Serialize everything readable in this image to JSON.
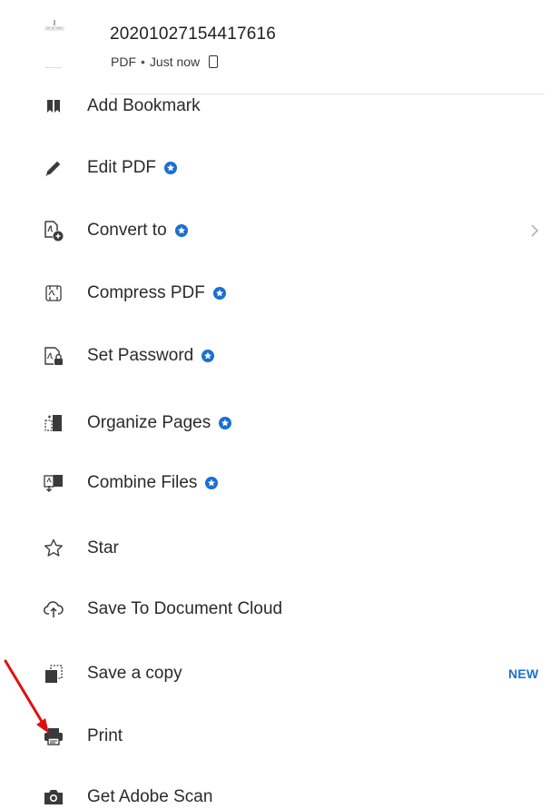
{
  "file": {
    "name": "20201027154417616",
    "type": "PDF",
    "separator": "•",
    "time": "Just now"
  },
  "menu": {
    "items": [
      {
        "label": "Add Bookmark",
        "icon": "bookmark-icon",
        "premium": false
      },
      {
        "label": "Edit PDF",
        "icon": "pencil-icon",
        "premium": true
      },
      {
        "label": "Convert to",
        "icon": "convert-icon",
        "premium": true,
        "has_submenu": true
      },
      {
        "label": "Compress PDF",
        "icon": "compress-icon",
        "premium": true
      },
      {
        "label": "Set Password",
        "icon": "lock-document-icon",
        "premium": true
      },
      {
        "label": "Organize Pages",
        "icon": "organize-pages-icon",
        "premium": true
      },
      {
        "label": "Combine Files",
        "icon": "combine-files-icon",
        "premium": true
      },
      {
        "label": "Star",
        "icon": "star-icon",
        "premium": false
      },
      {
        "label": "Save To Document Cloud",
        "icon": "cloud-upload-icon",
        "premium": false
      },
      {
        "label": "Save a copy",
        "icon": "save-copy-icon",
        "premium": false,
        "badge": "NEW"
      },
      {
        "label": "Print",
        "icon": "printer-icon",
        "premium": false
      },
      {
        "label": "Get Adobe Scan",
        "icon": "camera-icon",
        "premium": false
      }
    ]
  },
  "colors": {
    "premium_badge": "#1a6fd1",
    "new_badge": "#1a73c9",
    "annotation_arrow": "#e01010",
    "icon": "#3a3a3a"
  }
}
